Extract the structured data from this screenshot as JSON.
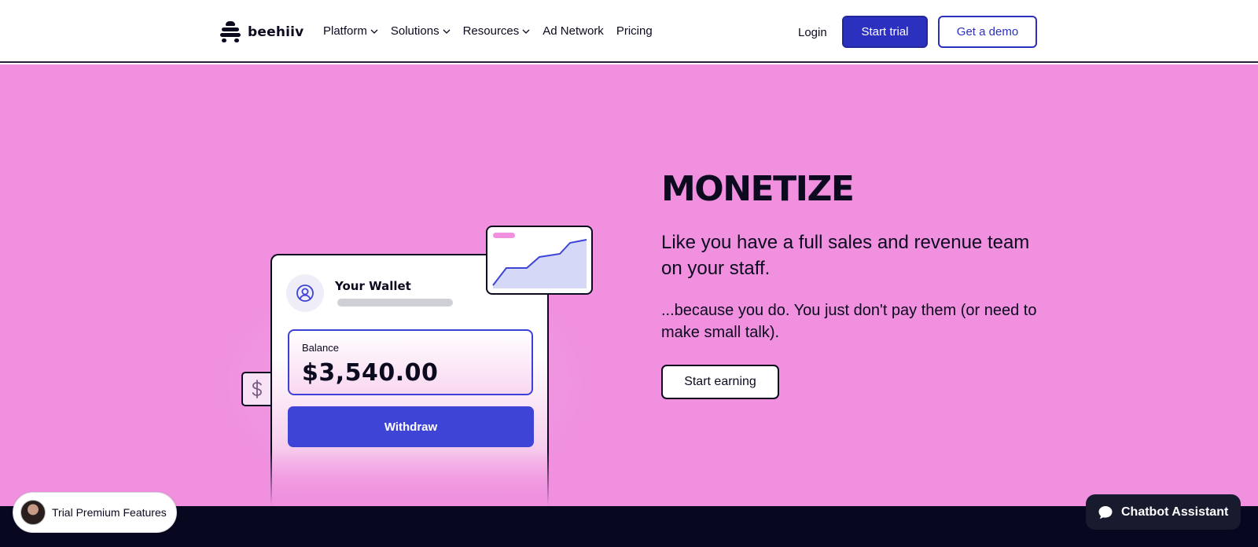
{
  "header": {
    "brand": "beehiiv",
    "nav": [
      {
        "label": "Platform",
        "has_dropdown": true
      },
      {
        "label": "Solutions",
        "has_dropdown": true
      },
      {
        "label": "Resources",
        "has_dropdown": true
      },
      {
        "label": "Ad Network",
        "has_dropdown": false
      },
      {
        "label": "Pricing",
        "has_dropdown": false
      }
    ],
    "login_label": "Login",
    "start_trial_label": "Start trial",
    "get_demo_label": "Get a demo"
  },
  "hero": {
    "background_color": "#f090df",
    "headline": "MONETIZE",
    "subheadline": "Like you have a full sales and revenue team on your staff.",
    "body": "...because you do. You just don't pay them (or need to make small talk).",
    "cta_label": "Start earning",
    "wallet": {
      "title": "Your Wallet",
      "balance_label": "Balance",
      "balance_value": "$3,540.00",
      "withdraw_label": "Withdraw",
      "currency_icon": "dollar-icon"
    }
  },
  "widgets": {
    "trial_label": "Trial Premium Features",
    "chat_label": "Chatbot Assistant"
  },
  "colors": {
    "brand_blue": "#2c30bf",
    "withdraw_blue": "#3d44d6",
    "hero_pink": "#f090df",
    "dark": "#080720"
  }
}
